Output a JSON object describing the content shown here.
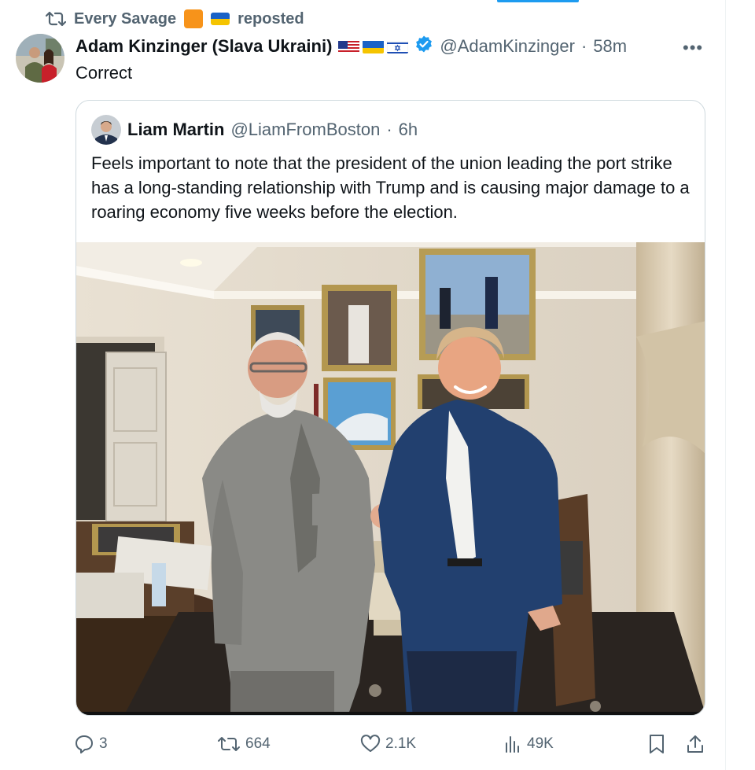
{
  "repost": {
    "user": "Every Savage",
    "label": "reposted"
  },
  "tweet": {
    "display_name": "Adam Kinzinger (Slava Ukraini)",
    "handle": "@AdamKinzinger",
    "separator": "·",
    "time": "58m",
    "more": "•••",
    "text": "Correct"
  },
  "quote": {
    "display_name": "Liam Martin",
    "handle": "@LiamFromBoston",
    "separator": "·",
    "time": "6h",
    "text": "Feels important to note that the president of the union leading the port strike has a long-standing relationship with Trump and is causing major damage to a roaring economy five weeks before the election."
  },
  "actions": {
    "replies": "3",
    "reposts": "664",
    "likes": "2.1K",
    "views": "49K"
  },
  "colors": {
    "accent": "#1d9bf0",
    "secondary_text": "#536471",
    "primary_text": "#0f1419",
    "border": "#cfd9de",
    "verified": "#1d9bf0"
  },
  "icons": [
    "repost-icon",
    "verified-badge-icon",
    "more-icon",
    "reply-icon",
    "like-icon",
    "views-icon",
    "bookmark-icon",
    "share-icon"
  ]
}
